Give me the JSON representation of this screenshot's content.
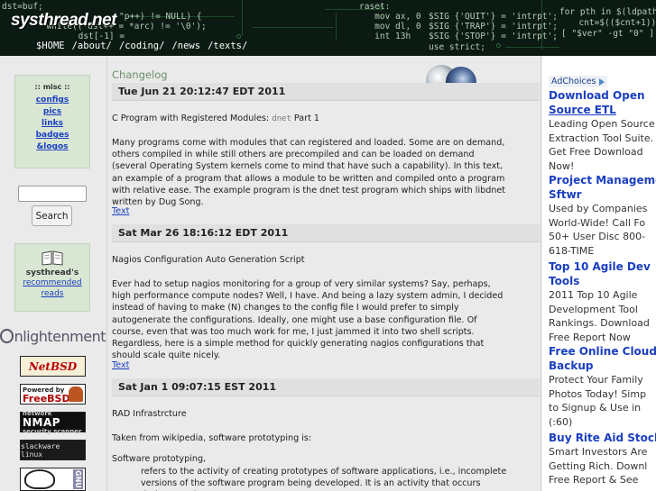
{
  "header": {
    "logo": "systhread.net",
    "code_lines": [
      "dst=buf;",
      "       \"p++) != NULL) {",
      "  while((*dst++ = *arc) != '\\0');",
      "     dst[-1] =",
      "raset:",
      "   mov ax, 0",
      "   mov dl, 0",
      "   int 13h",
      "$SIG {'QUIT'} = 'intrpt';",
      "$SIG {'TRAP'} = 'intrpt';",
      "$SIG {'STOP'} = 'intrpt';",
      "use strict;",
      "for pth in $(ldpath",
      "  cnt=$(($cnt+1))",
      "[ \"$ver\" -gt \"0\" ]"
    ],
    "nav": [
      "$HOME",
      "/about/",
      "/coding/",
      "/news",
      "/texts/"
    ]
  },
  "sidebar": {
    "misc_title": ":: misc ::",
    "misc_links": [
      "configs",
      "pics",
      "links",
      "badges",
      "&logos"
    ],
    "search": {
      "button_label": "Search",
      "value": ""
    },
    "reads": {
      "label": "systhread's",
      "link_lines": [
        "recommended",
        "reads"
      ]
    },
    "enlightenment_text": "nlightenment",
    "badges": {
      "netbsd": "NetBSD",
      "freebsd_small": "Powered by",
      "freebsd": "FreeBSD",
      "nmap_small": "network",
      "nmap": "NMAP",
      "nmap_sub": "security scanner",
      "slackware": "slackware linux",
      "gnu": "GNU"
    }
  },
  "main": {
    "heading": "Changelog",
    "posts": [
      {
        "date": "Tue Jun 21 20:12:47 EDT 2011",
        "title_pre": "C Program with Registered Modules: ",
        "title_code": "dnet",
        "title_post": " Part 1",
        "body": "Many programs come with modules that can registered and loaded. Some are on demand, others compiled in while still others are precompiled and can be loaded on demand (several Operating System kernels come to mind that have such a capability). In this text, an example of a program that allows a module to be written and compiled onto a program with relative ease. The example program is the dnet test program which ships with libdnet written by Dug Song.",
        "link": "Text"
      },
      {
        "date": "Sat Mar 26 18:16:12 EDT 2011",
        "title": "Nagios Configuration Auto Generation Script",
        "body": "Ever had to setup nagios monitoring for a group of very similar systems? Say, perhaps, high performance compute nodes? Well, I have. And being a lazy system admin, I decided instead of having to make (N) changes to the config file I would prefer to simply autogenerate the configurations. Ideally, one might use a base configuration file. Of course, even that was too much work for me, I just jammed it into two shell scripts. Regardless, here is a simple method for quickly generating nagios configurations that should scale quite nicely.",
        "link": "Text"
      },
      {
        "date": "Sat Jan 1 09:07:15 EST 2011",
        "title": "RAD Infrastrcture",
        "intro": "Taken from wikipedia, software prototyping is:",
        "term": "Software prototyping,",
        "definition": "refers to the activity of creating prototypes of software applications, i.e., incomplete versions of the software program being developed. It is an activity that occurs during certain"
      }
    ]
  },
  "ads": {
    "adchoices": "AdChoices",
    "items": [
      {
        "headline": [
          "Download Open",
          "Source ETL"
        ],
        "desc": [
          "Leading Open Source",
          "Extraction Tool Suite.",
          "Get Free Download",
          "Now!"
        ]
      },
      {
        "headline": [
          "Project Manageme",
          "Sftwr"
        ],
        "desc": [
          "Used by Companies",
          "World-Wide! Call Fo",
          "50+ User Disc 800-",
          "618-TIME"
        ]
      },
      {
        "headline": [
          "Top 10 Agile Dev",
          "Tools"
        ],
        "desc": [
          "2011 Top 10 Agile",
          "Development Tool",
          "Rankings. Download",
          "Free Report Now"
        ]
      },
      {
        "headline": [
          "Free Online Cloud",
          "Backup"
        ],
        "desc": [
          "Protect Your Family",
          "Photos Today! Simp",
          "to Signup & Use in",
          "(:60)"
        ]
      },
      {
        "headline": [
          "Buy Rite Aid Stock"
        ],
        "desc": [
          "Smart Investors Are",
          "Getting Rich. Downl",
          "Free Report & See"
        ]
      }
    ]
  }
}
